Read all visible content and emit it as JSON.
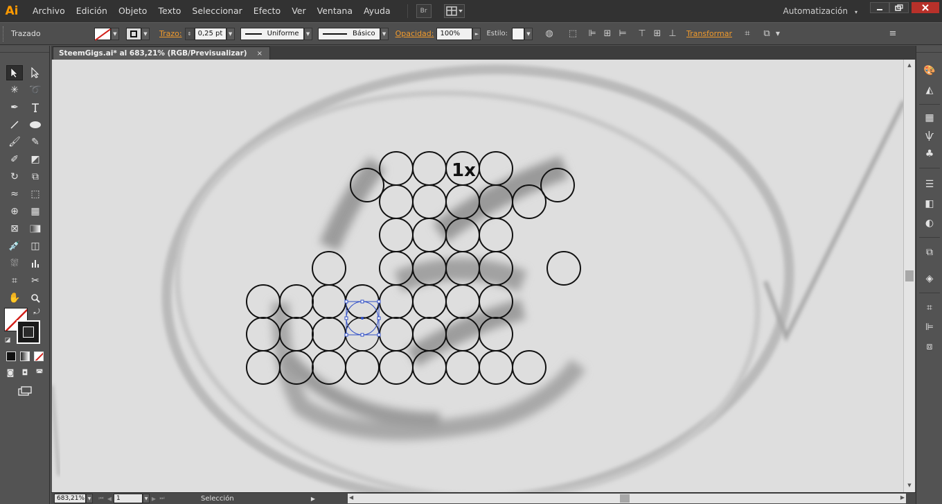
{
  "app": {
    "logo": "Ai",
    "menu": [
      "Archivo",
      "Edición",
      "Objeto",
      "Texto",
      "Seleccionar",
      "Efecto",
      "Ver",
      "Ventana",
      "Ayuda"
    ],
    "bridge_label": "Br",
    "workspace": "Automatización",
    "workspace_caret": "▾"
  },
  "control_bar": {
    "selection_type": "Trazado",
    "stroke_label": "Trazo:",
    "stroke_weight": "0,25 pt",
    "variable_width": "Uniforme",
    "brush": "Básico",
    "opacity_label": "Opacidad:",
    "opacity_value": "100%",
    "style_label": "Estilo:",
    "transform_label": "Transformar"
  },
  "document": {
    "tab_title": "SteemGigs.ai* al 683,21% (RGB/Previsualizar)",
    "close_glyph": "×",
    "artwork_text": "1x"
  },
  "status_bar": {
    "zoom": "683,21%",
    "page": "1",
    "current_tool": "Selección"
  },
  "colors": {
    "accent": "#f29b2c",
    "close_button": "#b8312a",
    "selection": "#2f4ec7"
  },
  "icons": {
    "tools": [
      "selection-tool-icon",
      "direct-selection-tool-icon",
      "magic-wand-tool-icon",
      "lasso-tool-icon",
      "pen-tool-icon",
      "type-tool-icon",
      "line-tool-icon",
      "ellipse-tool-icon",
      "paintbrush-tool-icon",
      "pencil-tool-icon",
      "blob-brush-tool-icon",
      "eraser-tool-icon",
      "rotate-tool-icon",
      "scale-tool-icon",
      "width-tool-icon",
      "free-transform-tool-icon",
      "shape-builder-tool-icon",
      "perspective-grid-tool-icon",
      "mesh-tool-icon",
      "gradient-tool-icon",
      "eyedropper-tool-icon",
      "blend-tool-icon",
      "symbol-sprayer-tool-icon",
      "column-graph-tool-icon",
      "artboard-tool-icon",
      "slice-tool-icon",
      "hand-tool-icon",
      "zoom-tool-icon"
    ],
    "panels": [
      "color-panel-icon",
      "color-guide-panel-icon",
      "swatches-panel-icon",
      "brushes-panel-icon",
      "symbols-panel-icon",
      "stroke-panel-icon",
      "gradient-panel-icon",
      "transparency-panel-icon",
      "graphic-styles-panel-icon",
      "layers-panel-icon",
      "align-panel-icon",
      "transform-panel-icon",
      "pathfinder-panel-icon"
    ]
  }
}
